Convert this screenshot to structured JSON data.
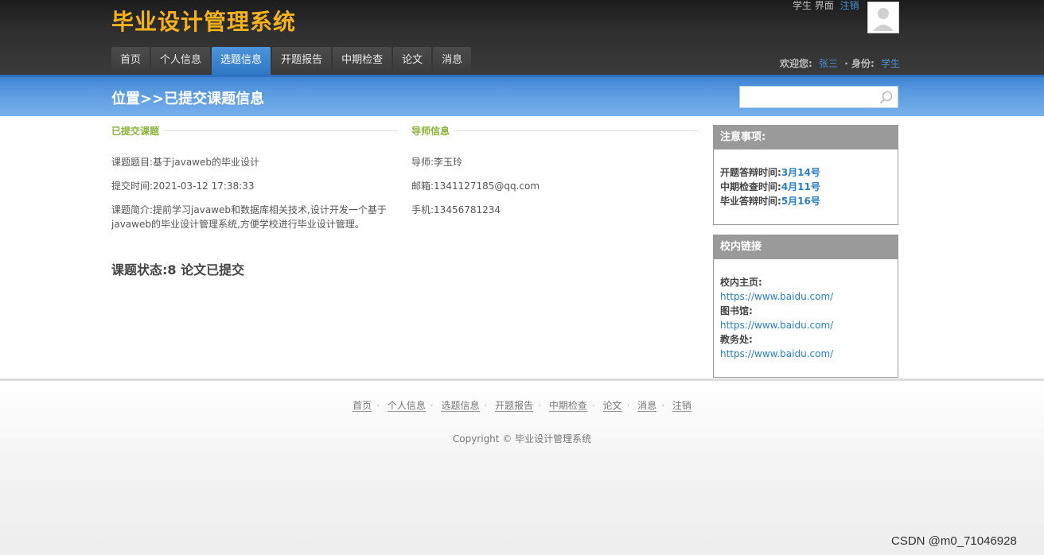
{
  "header": {
    "title": "毕业设计管理系统",
    "role_label": "学生 界面",
    "logout_label": "注销",
    "welcome_label": "欢迎您:",
    "user_name": "张三",
    "identity_label": "· 身份:",
    "identity_value": "学生"
  },
  "nav": {
    "tabs": [
      {
        "label": "首页",
        "active": false
      },
      {
        "label": "个人信息",
        "active": false
      },
      {
        "label": "选题信息",
        "active": true
      },
      {
        "label": "开题报告",
        "active": false
      },
      {
        "label": "中期检查",
        "active": false
      },
      {
        "label": "论文",
        "active": false
      },
      {
        "label": "消息",
        "active": false
      }
    ]
  },
  "location": {
    "title": "位置>>已提交课题信息",
    "search_placeholder": ""
  },
  "topic_section": {
    "heading": "已提交课题",
    "title_line": "课题题目:基于javaweb的毕业设计",
    "time_line": "提交时间:2021-03-12 17:38:33",
    "intro_line1": "课题简介:提前学习javaweb和数据库相关技术,设计开发一个基于",
    "intro_line2": "javaweb的毕业设计管理系统,方便学校进行毕业设计管理。"
  },
  "tutor_section": {
    "heading": "导师信息",
    "name_line": "导师:李玉玲",
    "email_line": "邮箱:1341127185@qq.com",
    "phone_line": "手机:13456781234"
  },
  "status_text": "课题状态:8 论文已提交",
  "notice_box": {
    "heading": "注意事项:",
    "items": [
      {
        "label": "开题答辩时间:",
        "date": "3月14号"
      },
      {
        "label": "中期检查时间:",
        "date": "4月11号"
      },
      {
        "label": "毕业答辩时间:",
        "date": "5月16号"
      }
    ]
  },
  "links_box": {
    "heading": "校内链接",
    "items": [
      {
        "label": "校内主页:",
        "url": "https://www.baidu.com/"
      },
      {
        "label": "图书馆:",
        "url": "https://www.baidu.com/"
      },
      {
        "label": "教务处:",
        "url": "https://www.baidu.com/"
      }
    ]
  },
  "footer": {
    "links": [
      "首页",
      "个人信息",
      "选题信息",
      "开题报告",
      "中期检查",
      "论文",
      "消息",
      "注销"
    ],
    "copyright": "Copyright © 毕业设计管理系统"
  },
  "credit": "CSDN @m0_71046928",
  "colors": {
    "brand_gold": "#f5b21c",
    "accent_blue": "#3f84d3",
    "section_green": "#8ab33a",
    "link_blue": "#2a7fc4"
  }
}
